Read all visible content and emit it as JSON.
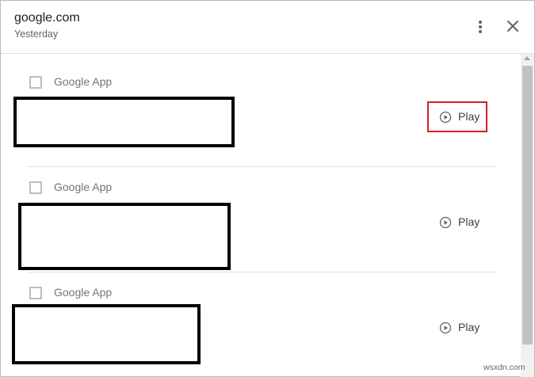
{
  "header": {
    "title": "google.com",
    "subtitle": "Yesterday",
    "more_icon": "more-vert-icon",
    "close_icon": "close-icon"
  },
  "entries": [
    {
      "app": "Google App",
      "play_label": "Play",
      "highlighted": true
    },
    {
      "app": "Google App",
      "play_label": "Play",
      "highlighted": false
    },
    {
      "app": "Google App",
      "play_label": "Play",
      "highlighted": false
    }
  ],
  "watermark": "wsxdn.com",
  "colors": {
    "highlight": "#d32020",
    "redaction": "#000000",
    "secondary_text": "#757575"
  }
}
